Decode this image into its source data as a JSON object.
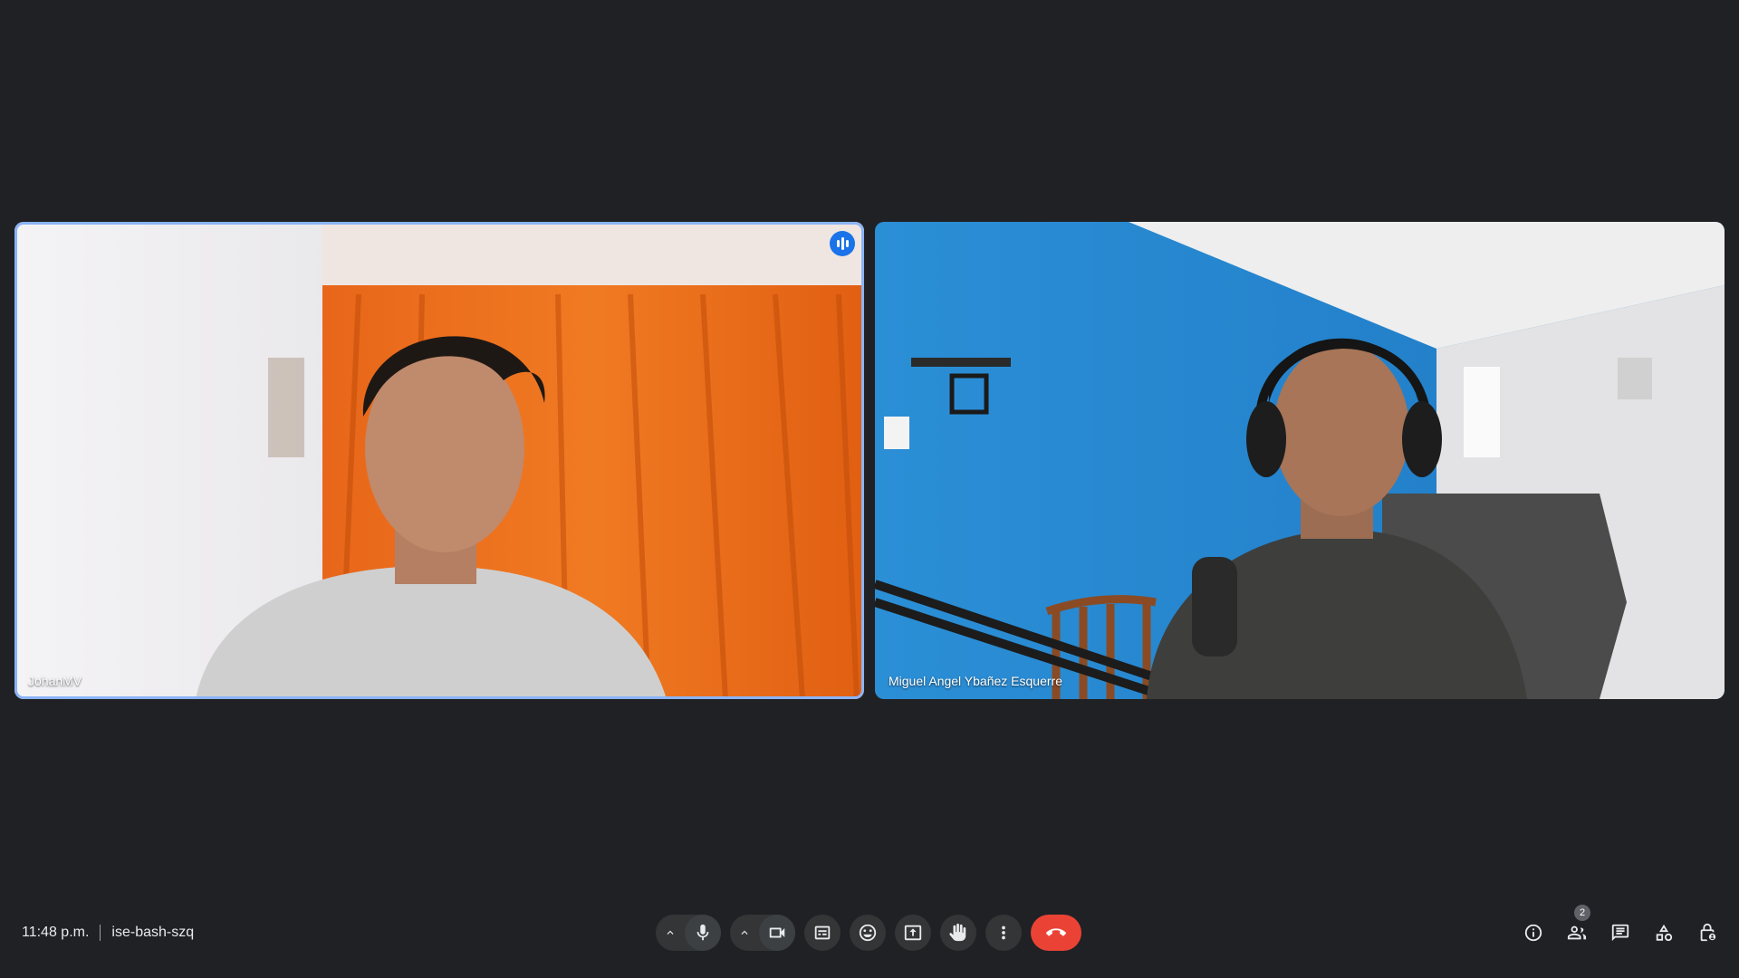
{
  "participants": [
    {
      "name": "JohanMV",
      "speaking": true
    },
    {
      "name": "Miguel Angel Ybañez Esquerre",
      "speaking": false
    }
  ],
  "meeting": {
    "time": "11:48 p.m.",
    "code": "ise-bash-szq"
  },
  "controls": {
    "mic_icon": "microphone-icon",
    "camera_icon": "video-camera-icon",
    "captions_icon": "closed-captions-icon",
    "reactions_icon": "emoji-icon",
    "present_icon": "present-screen-icon",
    "raise_hand_icon": "raise-hand-icon",
    "more_icon": "more-vert-icon",
    "end_call_icon": "call-end-icon"
  },
  "side_controls": {
    "people_count": "2"
  },
  "colors": {
    "background": "#202124",
    "end_call": "#ea4335",
    "speaking_border": "#8ab4f8",
    "speaking_indicator": "#1a73e8"
  }
}
